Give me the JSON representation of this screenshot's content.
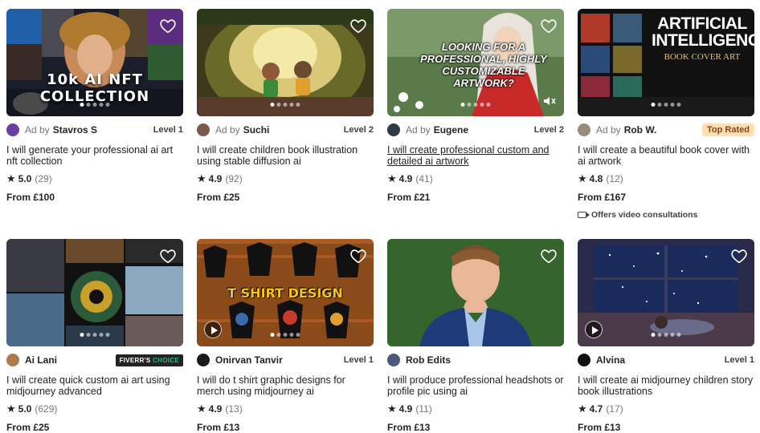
{
  "gigs": [
    {
      "ad": "Ad by",
      "seller": "Stavros S",
      "badge": "Level 1",
      "badge_type": "level",
      "title": "I will generate your professional ai art nft collection",
      "rating": "5.0",
      "count": "(29)",
      "price": "From £100",
      "overlay": "10k AI NFT COLLECTION"
    },
    {
      "ad": "Ad by",
      "seller": "Suchi",
      "badge": "Level 2",
      "badge_type": "level",
      "title": "I will create children book illustration using stable diffusion ai",
      "rating": "4.9",
      "count": "(92)",
      "price": "From £25"
    },
    {
      "ad": "Ad by",
      "seller": "Eugene",
      "badge": "Level 2",
      "badge_type": "level",
      "title": "I will create professional custom and detailed ai artwork",
      "rating": "4.9",
      "count": "(41)",
      "price": "From £21",
      "overlay": "LOOKING FOR A PROFESSIONAL, HIGHLY CUSTOMIZABLE ARTWORK?"
    },
    {
      "ad": "Ad by",
      "seller": "Rob W.",
      "badge": "Top Rated",
      "badge_type": "toprated",
      "title": "I will create a beautiful book cover with ai artwork",
      "rating": "4.8",
      "count": "(12)",
      "price": "From £167",
      "extra": "Offers video consultations",
      "overlay": "ARTIFICIAL INTELLIGENCE",
      "overlay_sub": "BOOK COVER ART"
    },
    {
      "seller": "Ai Lani",
      "badge_pre": "FIVERR'S",
      "badge": "CHOICE",
      "badge_type": "choice",
      "title": "I will create quick custom ai art using midjourney advanced",
      "rating": "5.0",
      "count": "(629)",
      "price": "From £25"
    },
    {
      "seller": "Onirvan Tanvir",
      "badge": "Level 1",
      "badge_type": "level",
      "title": "I will do t shirt graphic designs for merch using midjourney ai",
      "rating": "4.9",
      "count": "(13)",
      "price": "From £13",
      "overlay": "T SHIRT DESIGN"
    },
    {
      "seller": "Rob Edits",
      "badge": "",
      "badge_type": "none",
      "title": "I will produce professional headshots or profile pic using ai",
      "rating": "4.9",
      "count": "(11)",
      "price": "From £13"
    },
    {
      "seller": "Alvina",
      "badge": "Level 1",
      "badge_type": "level",
      "title": "I will create ai midjourney children story book illustrations",
      "rating": "4.7",
      "count": "(17)",
      "price": "From £13"
    }
  ],
  "icons": {
    "favorite": "heart-icon",
    "star": "star-icon",
    "video": "video-camera-icon",
    "play": "play-icon"
  },
  "colors": {
    "fiverr_green": "#1dbf73",
    "top_rated_bg": "#ffe0b3"
  }
}
